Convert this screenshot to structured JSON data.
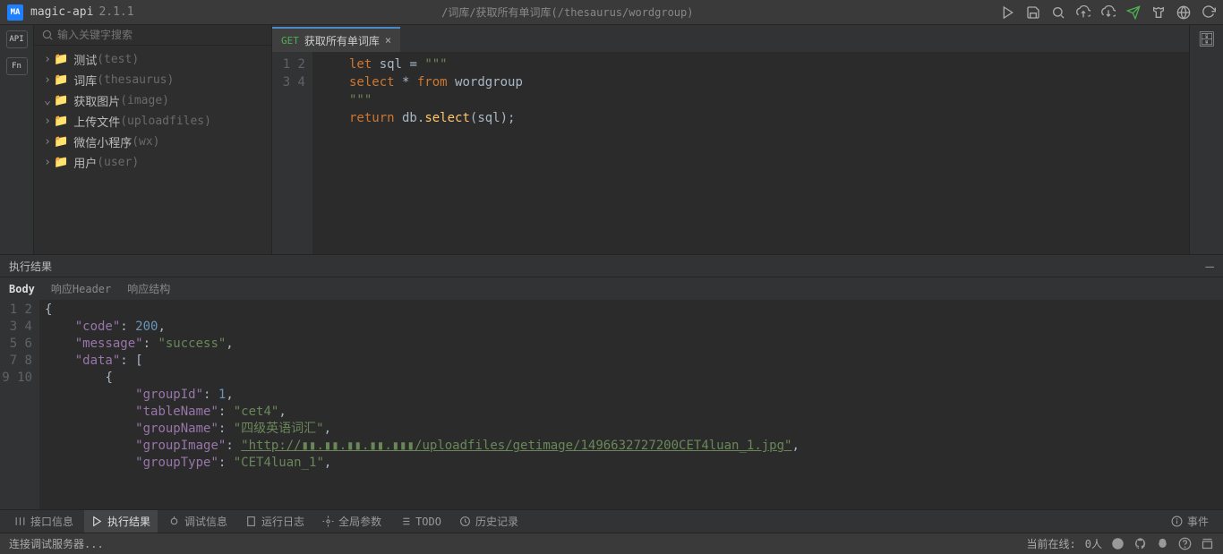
{
  "app": {
    "logo": "MA",
    "name": "magic-api",
    "version": "2.1.1"
  },
  "breadcrumb": "/词库/获取所有单词库(/thesaurus/wordgroup)",
  "search": {
    "placeholder": "输入关键字搜索"
  },
  "tree": [
    {
      "label": "测试",
      "suffix": "(test)",
      "expanded": false
    },
    {
      "label": "词库",
      "suffix": "(thesaurus)",
      "expanded": false
    },
    {
      "label": "获取图片",
      "suffix": "(image)",
      "expanded": true
    },
    {
      "label": "上传文件",
      "suffix": "(uploadfiles)",
      "expanded": false
    },
    {
      "label": "微信小程序",
      "suffix": "(wx)",
      "expanded": false
    },
    {
      "label": "用户",
      "suffix": "(user)",
      "expanded": false
    }
  ],
  "tab": {
    "method": "GET",
    "name": "获取所有单词库"
  },
  "code": {
    "l1_kw": "let",
    "l1_ident": " sql ",
    "l1_op": "= ",
    "l1_str": "\"\"\"",
    "l2_kw1": "select ",
    "l2_op": "* ",
    "l2_kw2": "from ",
    "l2_ident": "wordgroup",
    "l3_str": "\"\"\"",
    "l4_kw": "return",
    "l4_ident1": " db",
    "l4_dot": ".",
    "l4_fn": "select",
    "l4_p": "(sql);"
  },
  "result": {
    "title": "执行结果",
    "tabs": {
      "body": "Body",
      "header": "响应Header",
      "struct": "响应结构"
    },
    "json": {
      "code_key": "\"code\"",
      "code_val": "200",
      "message_key": "\"message\"",
      "message_val": "\"success\"",
      "data_key": "\"data\"",
      "groupId_key": "\"groupId\"",
      "groupId_val": "1",
      "tableName_key": "\"tableName\"",
      "tableName_val": "\"cet4\"",
      "groupName_key": "\"groupName\"",
      "groupName_val": "\"四级英语词汇\"",
      "groupImage_key": "\"groupImage\"",
      "groupImage_val": "\"http://▮▮.▮▮.▮▮.▮▮.▮▮▮/uploadfiles/getimage/1496632727200CET4luan_1.jpg\"",
      "groupType_key": "\"groupType\"",
      "groupType_val": "\"CET4luan_1\""
    }
  },
  "footer": {
    "api": "接口信息",
    "result": "执行结果",
    "debug": "调试信息",
    "log": "运行日志",
    "global": "全局参数",
    "todo": "TODO",
    "history": "历史记录",
    "event": "事件"
  },
  "status": {
    "left": "连接调试服务器...",
    "online_label": "当前在线:",
    "online_count": "0人"
  }
}
